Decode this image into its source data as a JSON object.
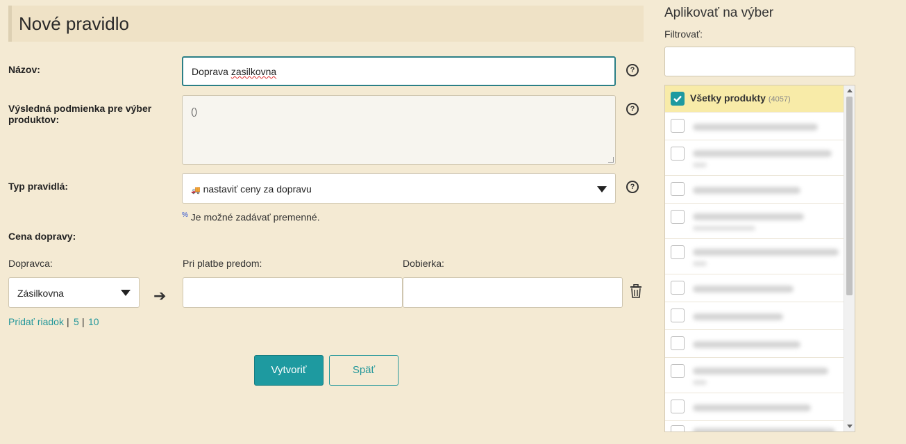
{
  "header": {
    "title": "Nové pravidlo"
  },
  "form": {
    "name_label": "Názov:",
    "name_value_prefix": "Doprava ",
    "name_value_misspelled": "zasilkovna",
    "condition_label": "Výsledná podmienka pre výber produktov:",
    "condition_value": "()",
    "rule_type_label": "Typ pravidlá:",
    "rule_type_icon": "🚚",
    "rule_type_value": "nastaviť ceny za dopravu",
    "variables_icon": "%",
    "variables_note": "Je možné zadávať premenné.",
    "shipping_price_label": "Cena dopravy:",
    "carrier_label": "Dopravca:",
    "prepaid_label": "Pri platbe predom:",
    "cod_label": "Dobierka:",
    "carrier_value": "Zásilkovna",
    "help_glyph": "?",
    "arrow_glyph": "➔",
    "add_row": "Pridať riadok",
    "add_5": "5",
    "add_10": "10",
    "separator": "|",
    "create_button": "Vytvoriť",
    "back_button": "Späť"
  },
  "sidebar": {
    "title": "Aplikovať na výber",
    "filter_label": "Filtrovať:",
    "filter_value": "",
    "all_products_label": "Všetky produkty",
    "all_products_count": "(4057)"
  },
  "colors": {
    "accent": "#1e9aa0",
    "background": "#f4ead3",
    "selected_row": "#f8eba8"
  },
  "icons": [
    "help-icon",
    "truck-icon",
    "arrow-right-icon",
    "trash-icon",
    "checkbox-checked-icon",
    "chevron-down-icon"
  ]
}
